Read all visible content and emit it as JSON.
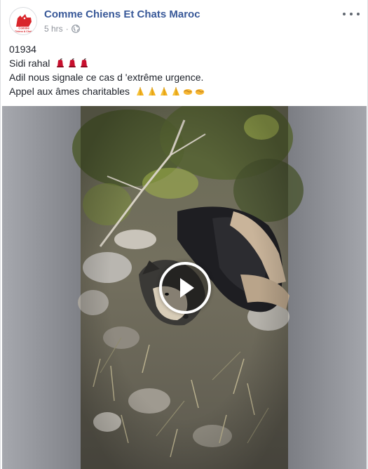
{
  "post": {
    "page_name": "Comme Chiens Et Chats Maroc",
    "timestamp": "5 hrs",
    "separator": "·",
    "privacy_icon": "globe-icon",
    "more_icon": "more-options-icon",
    "avatar_text_line1": "Comme",
    "avatar_text_line2": "Chiens & Chats",
    "message": {
      "line1": "01934",
      "line2": "Sidi rahal",
      "line2_emoji": [
        "red-hat-icon",
        "red-hat-icon",
        "red-hat-icon"
      ],
      "line3": "Adil nous signale ce cas d 'extrême urgence.",
      "line4": "Appel aux âmes charitables",
      "line4_emoji": [
        "folded-hands-icon",
        "folded-hands-icon",
        "folded-hands-icon",
        "folded-hands-icon",
        "handshake-icon",
        "handshake-icon"
      ]
    },
    "video": {
      "play_icon": "play-icon"
    }
  },
  "colors": {
    "brand_link": "#385898",
    "text": "#1d2129",
    "meta": "#90949c",
    "avatar_red": "#d9262b"
  }
}
